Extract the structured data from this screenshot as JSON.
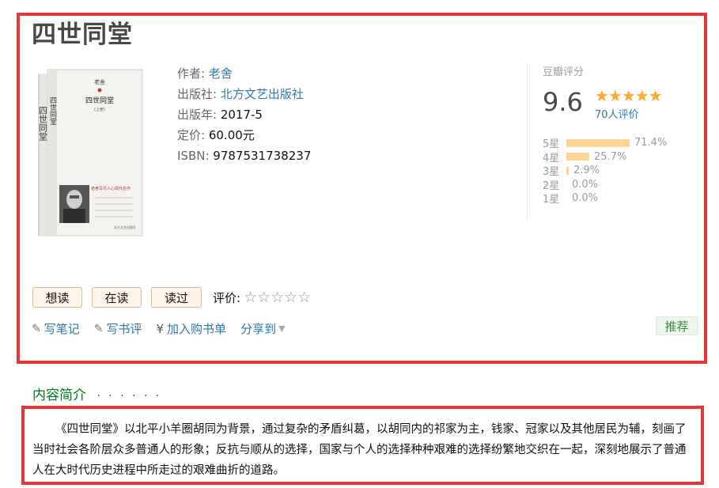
{
  "book": {
    "title": "四世同堂",
    "cover": {
      "author": "老舍",
      "title": "四世同堂",
      "volume": "(上册)",
      "blurb": "老舍写尽人心现代名作",
      "publisher_mark": "北方文艺出版社"
    },
    "info": [
      {
        "label": "作者:",
        "value": "老舍",
        "link": true
      },
      {
        "label": "出版社:",
        "value": "北方文艺出版社",
        "link": true
      },
      {
        "label": "出版年:",
        "value": "2017-5",
        "link": false
      },
      {
        "label": "定价:",
        "value": "60.00元",
        "link": false
      },
      {
        "label": "ISBN:",
        "value": "9787531738237",
        "link": false
      }
    ]
  },
  "rating": {
    "title": "豆瓣评分",
    "score": "9.6",
    "stars": "★★★★★",
    "count": "70人评价",
    "distribution": [
      {
        "label": "5星",
        "percent": "71.4%",
        "value": 71.4
      },
      {
        "label": "4星",
        "percent": "25.7%",
        "value": 25.7
      },
      {
        "label": "3星",
        "percent": "2.9%",
        "value": 2.9
      },
      {
        "label": "2星",
        "percent": "0.0%",
        "value": 0.0
      },
      {
        "label": "1星",
        "percent": "0.0%",
        "value": 0.0
      }
    ],
    "bar_color": "#ffd596"
  },
  "buttons": {
    "want": "想读",
    "reading": "在读",
    "read": "读过",
    "rate_label": "评价:",
    "rate_stars": "☆☆☆☆☆"
  },
  "actions": {
    "note": "写笔记",
    "review": "写书评",
    "cart": "加入购书单",
    "share": "分享到",
    "recommend": "推荐"
  },
  "intro": {
    "heading": "内容简介",
    "dots": "· · · · · ·",
    "text": "《四世同堂》以北平小羊圈胡同为背景，通过复杂的矛盾纠葛，以胡同内的祁家为主，钱家、冠家以及其他居民为辅，刻画了当时社会各阶层众多普通人的形象；反抗与顺从的选择，国家与个人的选择种种艰难的选择纷繁地交织在一起，深刻地展示了普通人在大时代历史进程中所走过的艰难曲折的道路。"
  },
  "colors": {
    "link": "#3377aa",
    "highlight_border": "#e8353b",
    "section_green": "#007722",
    "star": "#ffac2d"
  }
}
